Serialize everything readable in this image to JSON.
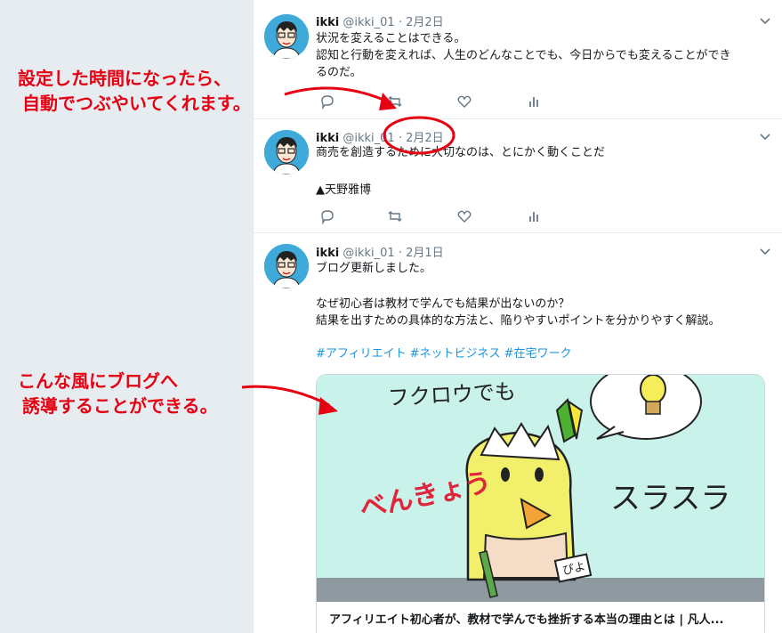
{
  "tweets": [
    {
      "name": "ikki",
      "handle": "@ikki_01",
      "dot": "·",
      "date": "2月2日",
      "lines": [
        "状況を変えることはできる。",
        "認知と行動を変えれば、人生のどんなことでも、今日からでも変えることができ",
        "るのだ。"
      ]
    },
    {
      "name": "ikki",
      "handle": "@ikki_01",
      "dot": "·",
      "date": "2月2日",
      "lines": [
        "商売を創造するために大切なのは、とにかく動くことだ",
        "",
        "▲天野雅博"
      ]
    },
    {
      "name": "ikki",
      "handle": "@ikki_01",
      "dot": "·",
      "date": "2月1日",
      "lines": [
        "ブログ更新しました。",
        "",
        "なぜ初心者は教材で学んでも結果が出ないのか？",
        "結果を出すための具体的な方法と、陥りやすいポイントを分かりやすく解説。"
      ],
      "hashtags": [
        "#アフィリエイト",
        "#ネットビジネス",
        "#在宅ワーク"
      ],
      "card": {
        "image_text_top": "フクロウでも",
        "image_text_left": "べんきょう",
        "image_text_right": "スラスラ",
        "image_text_tag": "ぴよ",
        "title": "アフィリエイト初心者が、教材で学んでも挫折する本当の理由とは | 凡人..."
      }
    }
  ],
  "annotations": {
    "first": [
      "設定した時間になったら、",
      "自動でつぶやいてくれます。"
    ],
    "second": [
      "こんな風にブログへ",
      "誘導することができる。"
    ]
  },
  "colors": {
    "annotation": "#e60012",
    "link": "#1b95e0",
    "muted": "#657786",
    "background": "#e6ecf0"
  },
  "icons": [
    "reply-icon",
    "retweet-icon",
    "like-icon",
    "analytics-icon",
    "chevron-down-icon"
  ]
}
